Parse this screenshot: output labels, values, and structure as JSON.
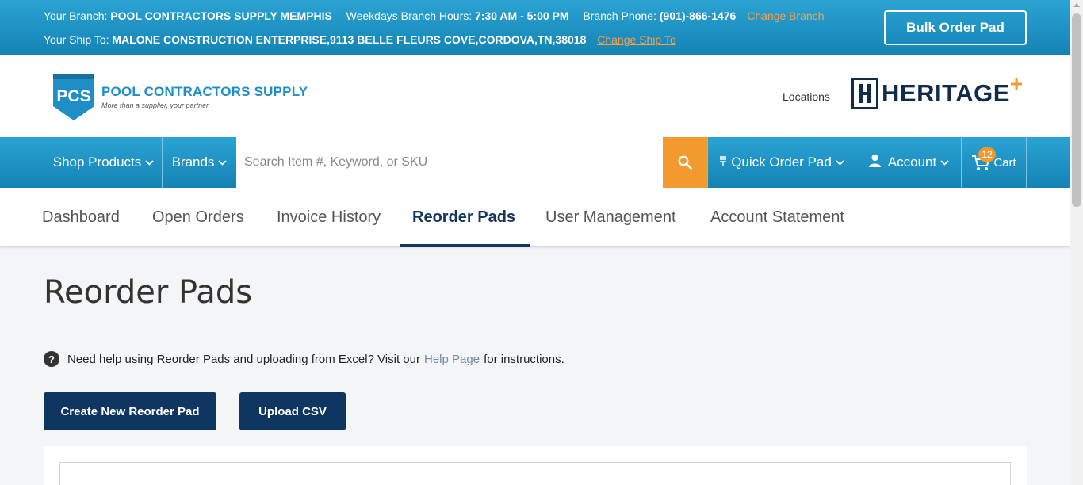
{
  "topbar": {
    "branch_label": "Your Branch:",
    "branch_name": "POOL CONTRACTORS SUPPLY MEMPHIS",
    "hours_label": "Weekdays Branch Hours:",
    "hours_value": "7:30 AM - 5:00 PM",
    "phone_label": "Branch Phone:",
    "phone_value": "(901)-866-1476",
    "change_branch": "Change Branch",
    "ship_label": "Your Ship To:",
    "ship_value": "MALONE CONSTRUCTION ENTERPRISE,9113 BELLE FLEURS COVE,CORDOVA,TN,38018",
    "change_ship": "Change Ship To",
    "bulk_order": "Bulk Order Pad"
  },
  "header": {
    "logo_mark": "PCS",
    "logo_name": "POOL CONTRACTORS SUPPLY",
    "logo_tagline": "More than a supplier, your partner.",
    "locations": "Locations",
    "partner_logo": "HERITAGE"
  },
  "nav": {
    "shop_products": "Shop Products",
    "brands": "Brands",
    "search_placeholder": "Search Item #, Keyword, or SKU",
    "quick_order": "Quick Order Pad",
    "account": "Account",
    "cart": "Cart",
    "cart_count": "12"
  },
  "tabs": {
    "items": [
      {
        "label": "Dashboard"
      },
      {
        "label": "Open Orders"
      },
      {
        "label": "Invoice History"
      },
      {
        "label": "Reorder Pads"
      },
      {
        "label": "User Management"
      },
      {
        "label": "Account Statement"
      }
    ],
    "active": "Reorder Pads"
  },
  "main": {
    "title": "Reorder Pads",
    "help_prefix": "Need help using Reorder Pads and uploading from Excel? Visit our",
    "help_link": "Help Page",
    "help_suffix": "for instructions.",
    "create_button": "Create New Reorder Pad",
    "upload_button": "Upload CSV"
  },
  "colors": {
    "brand_blue": "#1e8fc6",
    "navy": "#0f3660",
    "accent_orange": "#f39a2e"
  }
}
